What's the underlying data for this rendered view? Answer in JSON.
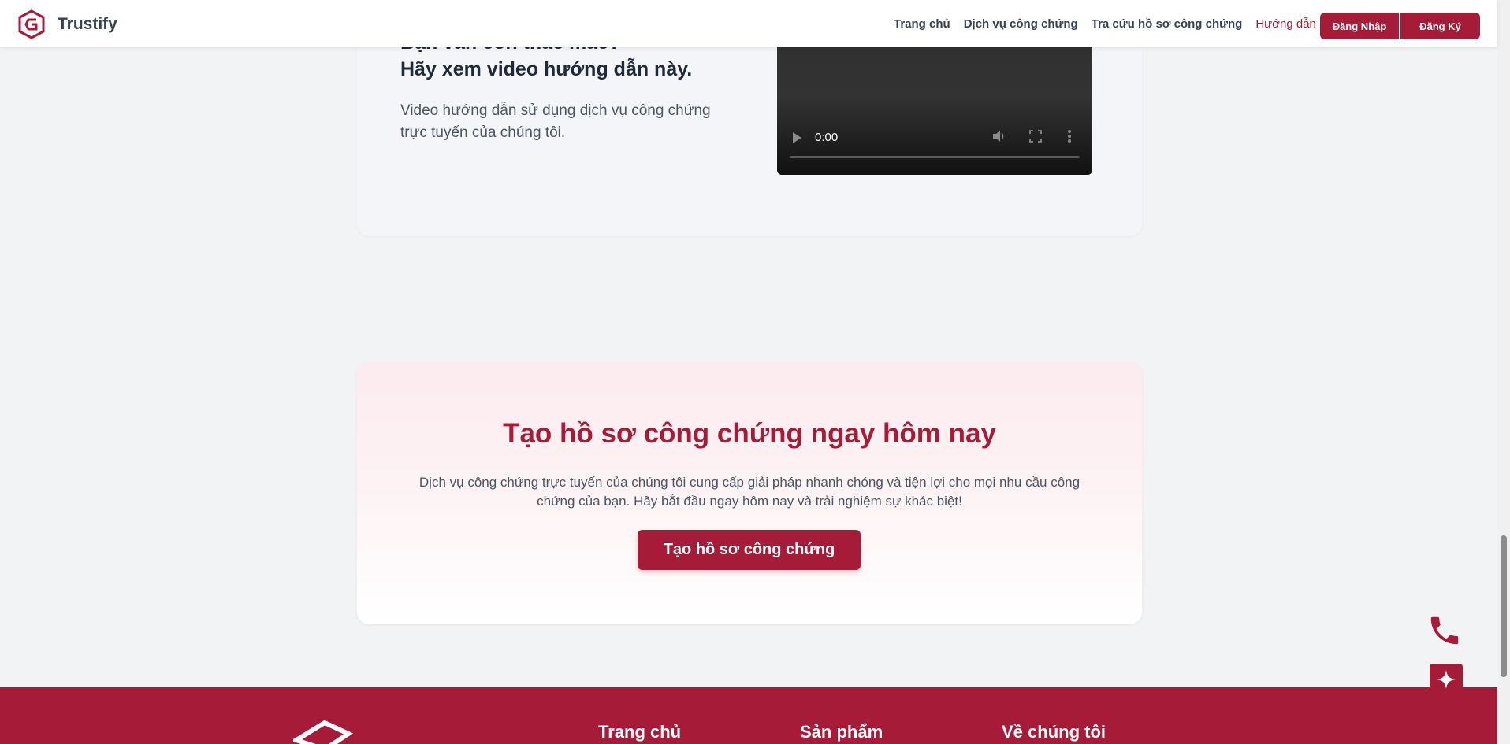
{
  "header": {
    "brand": "Trustify",
    "nav": [
      {
        "label": "Trang chủ"
      },
      {
        "label": "Dịch vụ công chứng"
      },
      {
        "label": "Tra cứu hồ sơ công chứng"
      },
      {
        "label": "Hướng dẫn"
      }
    ],
    "login_label": "Đăng Nhập",
    "register_label": "Đăng Ký"
  },
  "video_section": {
    "heading_line1": "Bạn vẫn còn thắc mắc?",
    "heading_line2": "Hãy xem video hướng dẫn này.",
    "description": "Video hướng dẫn sử dụng dịch vụ công chứng trực tuyến của chúng tôi.",
    "video_time": "0:00"
  },
  "cta": {
    "title": "Tạo hồ sơ công chứng ngay hôm nay",
    "description": "Dịch vụ công chứng trực tuyến của chúng tôi cung cấp giải pháp nhanh chóng và tiện lợi cho mọi nhu cầu công chứng của bạn. Hãy bắt đầu ngay hôm nay và trải nghiệm sự khác biệt!",
    "button_label": "Tạo hồ sơ công chứng"
  },
  "footer": {
    "columns": [
      {
        "title": "Trang chủ"
      },
      {
        "title": "Sản phẩm"
      },
      {
        "title": "Về chúng tôi"
      }
    ]
  },
  "icons": {
    "logo": "trustify-logo-icon",
    "phone": "phone-icon",
    "sparkle": "sparkle-icon",
    "play": "play-icon",
    "volume": "volume-icon",
    "fullscreen": "fullscreen-icon",
    "more": "more-vertical-icon"
  },
  "colors": {
    "brand": "#a61c38",
    "text": "#1f2937",
    "muted": "#4b5563",
    "background": "#f2f3f5"
  }
}
